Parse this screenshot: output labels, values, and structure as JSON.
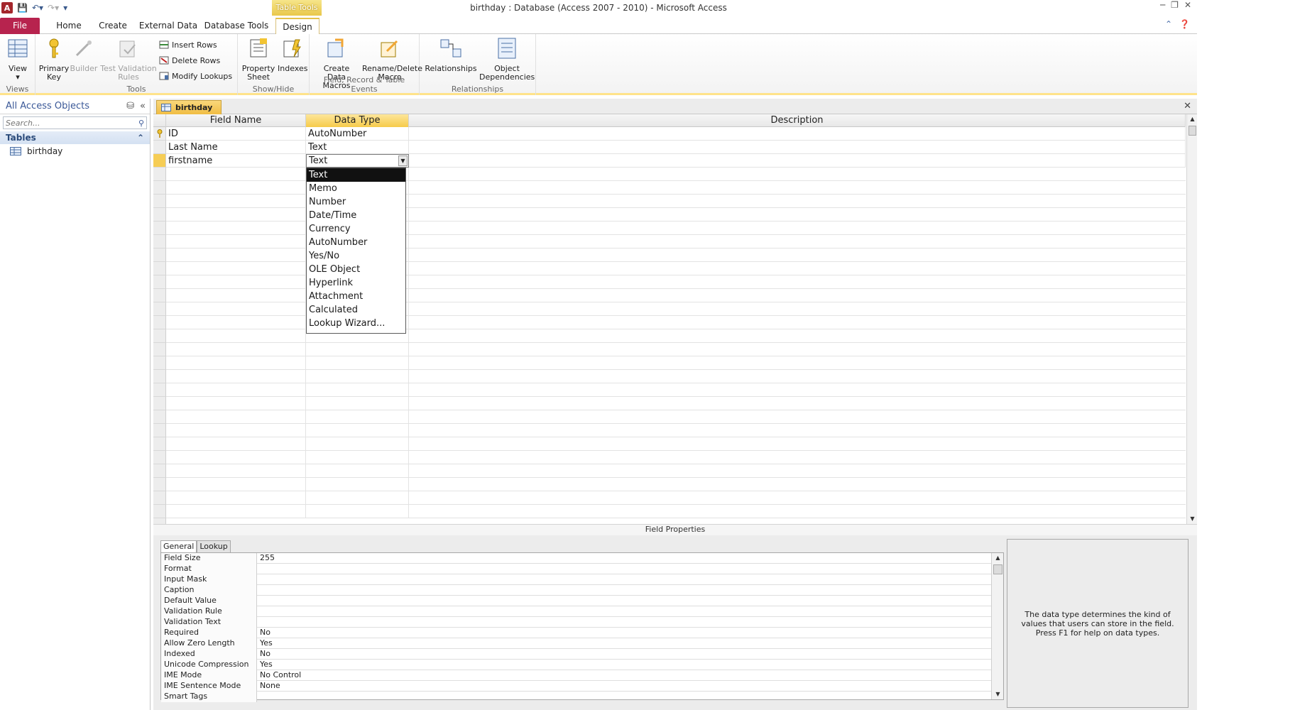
{
  "window": {
    "title": "birthday : Database (Access 2007 - 2010)  -  Microsoft Access",
    "contextual_tab_group": "Table Tools"
  },
  "tabs": [
    {
      "label": "File"
    },
    {
      "label": "Home"
    },
    {
      "label": "Create"
    },
    {
      "label": "External Data"
    },
    {
      "label": "Database Tools"
    },
    {
      "label": "Design"
    }
  ],
  "ribbon": {
    "views": {
      "label": "Views",
      "view_btn": "View"
    },
    "tools": {
      "label": "Tools",
      "primary_key": [
        "Primary",
        "Key"
      ],
      "builder": "Builder",
      "test_validation": [
        "Test Validation",
        "Rules"
      ],
      "insert_rows": "Insert Rows",
      "delete_rows": "Delete Rows",
      "modify_lookups": "Modify Lookups"
    },
    "show_hide": {
      "label": "Show/Hide",
      "property_sheet": [
        "Property",
        "Sheet"
      ],
      "indexes": "Indexes"
    },
    "events": {
      "label": "Field, Record & Table Events",
      "create_data_macros": [
        "Create Data",
        "Macros"
      ],
      "rename_delete_macro": [
        "Rename/Delete",
        "Macro"
      ]
    },
    "relationships": {
      "label": "Relationships",
      "relationships_btn": "Relationships",
      "object_dependencies": [
        "Object",
        "Dependencies"
      ]
    }
  },
  "nav": {
    "header": "All Access Objects",
    "search_placeholder": "Search...",
    "group": "Tables",
    "items": [
      {
        "label": "birthday"
      }
    ]
  },
  "document": {
    "tab": "birthday",
    "columns": [
      "Field Name",
      "Data Type",
      "Description"
    ],
    "rows": [
      {
        "field": "ID",
        "type": "AutoNumber",
        "desc": ""
      },
      {
        "field": "Last Name",
        "type": "Text",
        "desc": ""
      },
      {
        "field": "firstname",
        "type": "Text",
        "desc": ""
      }
    ],
    "datatype_options": [
      "Text",
      "Memo",
      "Number",
      "Date/Time",
      "Currency",
      "AutoNumber",
      "Yes/No",
      "OLE Object",
      "Hyperlink",
      "Attachment",
      "Calculated",
      "Lookup Wizard..."
    ],
    "selected_option": "Text"
  },
  "field_properties": {
    "title": "Field Properties",
    "tabs": [
      "General",
      "Lookup"
    ],
    "rows": [
      {
        "label": "Field Size",
        "value": "255"
      },
      {
        "label": "Format",
        "value": ""
      },
      {
        "label": "Input Mask",
        "value": ""
      },
      {
        "label": "Caption",
        "value": ""
      },
      {
        "label": "Default Value",
        "value": ""
      },
      {
        "label": "Validation Rule",
        "value": ""
      },
      {
        "label": "Validation Text",
        "value": ""
      },
      {
        "label": "Required",
        "value": "No"
      },
      {
        "label": "Allow Zero Length",
        "value": "Yes"
      },
      {
        "label": "Indexed",
        "value": "No"
      },
      {
        "label": "Unicode Compression",
        "value": "Yes"
      },
      {
        "label": "IME Mode",
        "value": "No Control"
      },
      {
        "label": "IME Sentence Mode",
        "value": "None"
      },
      {
        "label": "Smart Tags",
        "value": ""
      }
    ],
    "help_text": "The data type determines the kind of values that users can store in the field. Press F1 for help on data types."
  },
  "colors": {
    "file_tab": "#b7234e",
    "active_header": "#f6cb4a",
    "accent_border": "#ffe38a"
  }
}
